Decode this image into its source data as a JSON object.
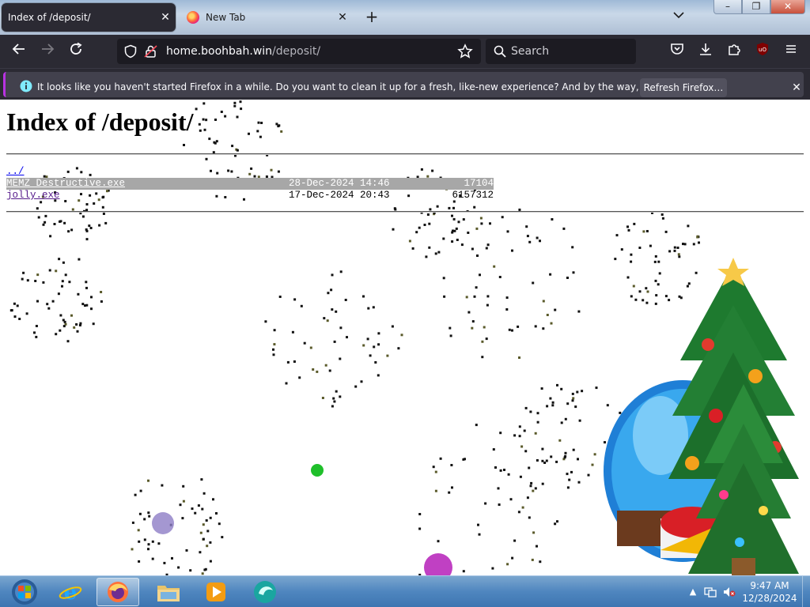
{
  "browser": {
    "tabs": [
      {
        "title": "Index of /deposit/",
        "active": true
      },
      {
        "title": "New Tab",
        "active": false
      }
    ],
    "window_buttons": {
      "minimize": "–",
      "restore": "❐",
      "close": "✕"
    },
    "url": {
      "host": "home.boohbah.win",
      "path": "/deposit/"
    },
    "search_placeholder": "Search",
    "notification": {
      "text": "It looks like you haven't started Firefox in a while. Do you want to clean it up for a fresh, like-new experience? And by the way, welcome back!",
      "button": "Refresh Firefox…"
    },
    "accent_color": "#b833e1"
  },
  "page": {
    "title": "Index of /deposit/",
    "parent_link": "../",
    "files": [
      {
        "name": "MEMZ_Destructive.exe",
        "date": "28-Dec-2024 14:46",
        "size": "17104",
        "selected": true
      },
      {
        "name": "jolly.exe",
        "date": "17-Dec-2024 20:43",
        "size": "6157312",
        "selected": false
      }
    ]
  },
  "taskbar": {
    "apps": [
      "start-orb",
      "internet-explorer",
      "firefox",
      "file-explorer",
      "media-player",
      "browser-app"
    ],
    "clock": {
      "time": "9:47 AM",
      "date": "12/28/2024"
    }
  }
}
